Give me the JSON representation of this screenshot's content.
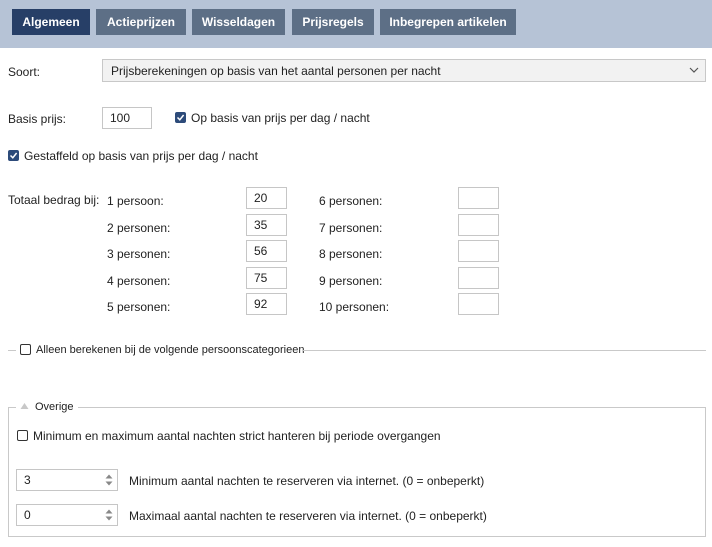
{
  "tabs": [
    {
      "label": "Algemeen",
      "active": true
    },
    {
      "label": "Actieprijzen",
      "active": false
    },
    {
      "label": "Wisseldagen",
      "active": false
    },
    {
      "label": "Prijsregels",
      "active": false
    },
    {
      "label": "Inbegrepen artikelen",
      "active": false
    }
  ],
  "soort": {
    "label": "Soort:",
    "value": "Prijsberekeningen op basis van het aantal personen per nacht"
  },
  "basis": {
    "label": "Basis prijs:",
    "value": "100",
    "checkbox_label": "Op basis van prijs per dag / nacht",
    "checked": true
  },
  "gestaffeld": {
    "label": "Gestaffeld op basis van prijs per dag / nacht",
    "checked": true
  },
  "totaal": {
    "label": "Totaal bedrag bij:",
    "left": [
      {
        "label": "1 persoon:",
        "value": "20"
      },
      {
        "label": "2 personen:",
        "value": "35"
      },
      {
        "label": "3 personen:",
        "value": "56"
      },
      {
        "label": "4 personen:",
        "value": "75"
      },
      {
        "label": "5 personen:",
        "value": "92"
      }
    ],
    "right": [
      {
        "label": "6 personen:",
        "value": ""
      },
      {
        "label": "7 personen:",
        "value": ""
      },
      {
        "label": "8 personen:",
        "value": ""
      },
      {
        "label": "9 personen:",
        "value": ""
      },
      {
        "label": "10 personen:",
        "value": ""
      }
    ]
  },
  "alleen": {
    "label": "Alleen berekenen bij de volgende persoonscategorieen",
    "checked": false
  },
  "overige": {
    "legend": "Overige",
    "strict_label": "Minimum en maximum aantal nachten strict hanteren bij periode overgangen",
    "strict_checked": false,
    "min_value": "3",
    "min_label": "Minimum aantal nachten te reserveren via internet. (0 = onbeperkt)",
    "max_value": "0",
    "max_label": "Maximaal aantal nachten te reserveren via internet. (0 = onbeperkt)"
  },
  "icons": {
    "dropdown": "chevron-down-icon",
    "checkmark": "check-icon",
    "collapse": "triangle-up-icon",
    "spinner": "spinner-arrows-icon"
  }
}
